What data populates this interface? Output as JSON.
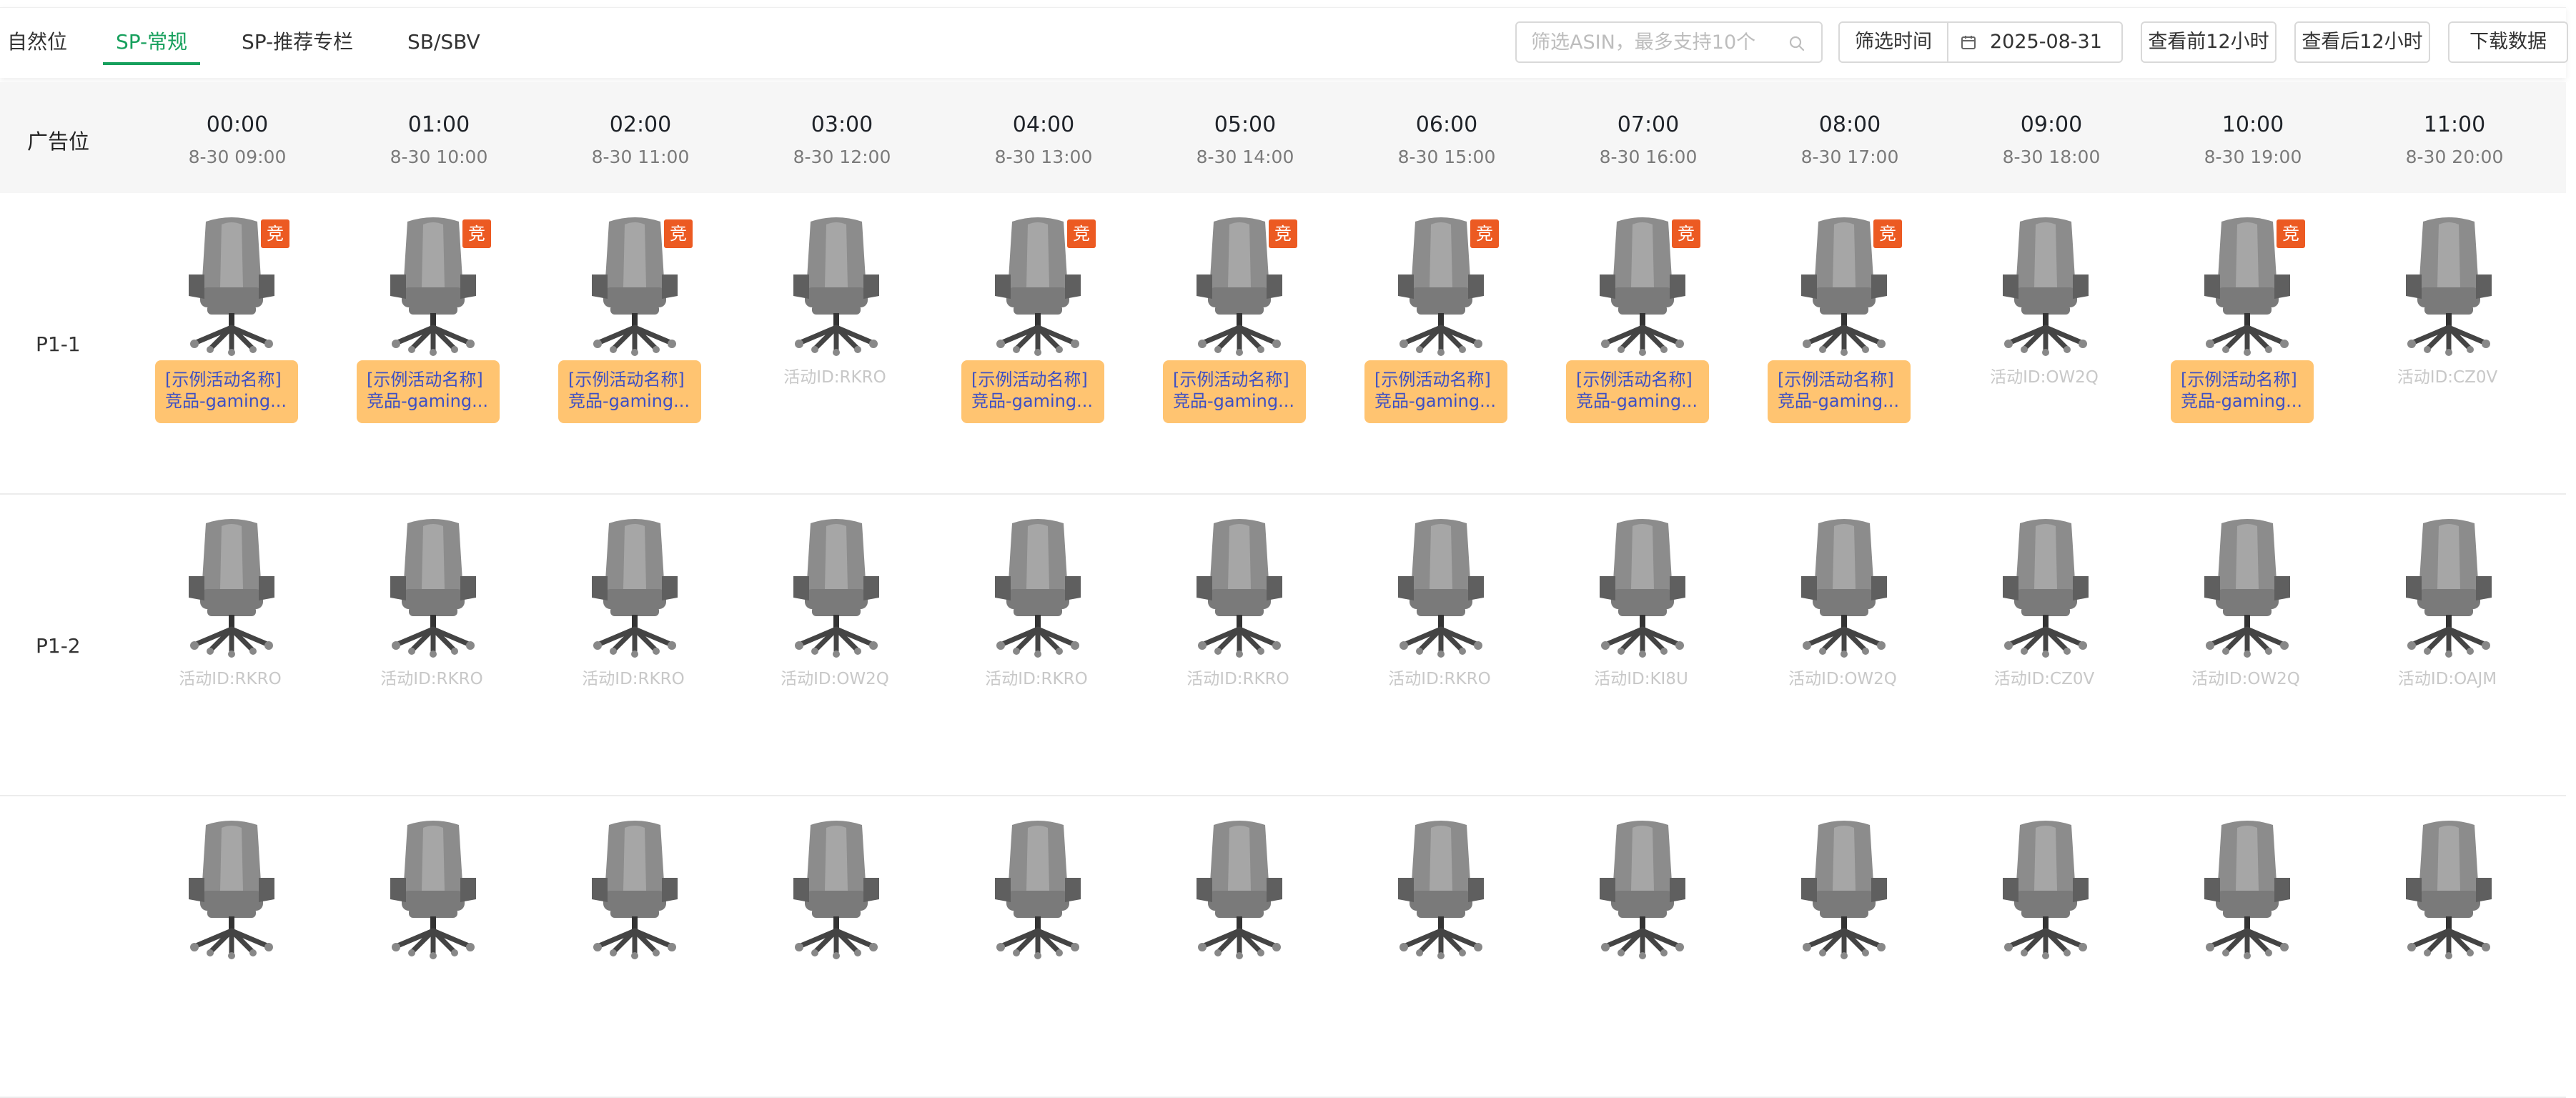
{
  "tabs": [
    {
      "label": "自然位",
      "active": false
    },
    {
      "label": "SP-常规",
      "active": true
    },
    {
      "label": "SP-推荐专栏",
      "active": false
    },
    {
      "label": "SB/SBV",
      "active": false
    }
  ],
  "controls": {
    "search_placeholder": "筛选ASIN，最多支持10个",
    "filter_time_label": "筛选时间",
    "date_value": "2025-08-31",
    "prev_12h_label": "查看前12小时",
    "next_12h_label": "查看后12小时",
    "download_label": "下载数据"
  },
  "colors": {
    "accent": "#17a05d",
    "badge": "#ec5a22",
    "campaign_box": "#ffc471",
    "campaign_text": "#3d4fc4",
    "header_bg": "#f6f6f6"
  },
  "grid": {
    "corner_label": "广告位",
    "columns": [
      {
        "hour": "00:00",
        "slot": "8-30 09:00"
      },
      {
        "hour": "01:00",
        "slot": "8-30 10:00"
      },
      {
        "hour": "02:00",
        "slot": "8-30 11:00"
      },
      {
        "hour": "03:00",
        "slot": "8-30 12:00"
      },
      {
        "hour": "04:00",
        "slot": "8-30 13:00"
      },
      {
        "hour": "05:00",
        "slot": "8-30 14:00"
      },
      {
        "hour": "06:00",
        "slot": "8-30 15:00"
      },
      {
        "hour": "07:00",
        "slot": "8-30 16:00"
      },
      {
        "hour": "08:00",
        "slot": "8-30 17:00"
      },
      {
        "hour": "09:00",
        "slot": "8-30 18:00"
      },
      {
        "hour": "10:00",
        "slot": "8-30 19:00"
      },
      {
        "hour": "11:00",
        "slot": "8-30 20:00"
      }
    ],
    "rows": [
      {
        "label": "P1-1",
        "cells": [
          {
            "chair": "bw-gaming",
            "badge": "竞",
            "campaign": [
              "[示例活动名称]",
              "竞品-gaming..."
            ]
          },
          {
            "chair": "bw-gaming",
            "badge": "竞",
            "campaign": [
              "[示例活动名称]",
              "竞品-gaming..."
            ]
          },
          {
            "chair": "bw-gaming",
            "badge": "竞",
            "campaign": [
              "[示例活动名称]",
              "竞品-gaming..."
            ]
          },
          {
            "chair": "navy-white",
            "activity_id": "活动ID:RKRO"
          },
          {
            "chair": "bw-gaming",
            "badge": "竞",
            "campaign": [
              "[示例活动名称]",
              "竞品-gaming..."
            ]
          },
          {
            "chair": "bw-gaming",
            "badge": "竞",
            "campaign": [
              "[示例活动名称]",
              "竞品-gaming..."
            ]
          },
          {
            "chair": "bw-gaming",
            "badge": "竞",
            "campaign": [
              "[示例活动名称]",
              "竞品-gaming..."
            ]
          },
          {
            "chair": "bw-gaming",
            "badge": "竞",
            "campaign": [
              "[示例活动名称]",
              "竞品-gaming..."
            ]
          },
          {
            "chair": "bw-gaming",
            "badge": "竞",
            "campaign": [
              "[示例活动名称]",
              "竞品-gaming..."
            ]
          },
          {
            "chair": "black-office",
            "activity_id": "活动ID:OW2Q"
          },
          {
            "chair": "bw-gaming",
            "badge": "竞",
            "campaign": [
              "[示例活动名称]",
              "竞品-gaming..."
            ]
          },
          {
            "chair": "black-office",
            "activity_id": "活动ID:CZ0V"
          }
        ]
      },
      {
        "label": "P1-2",
        "cells": [
          {
            "chair": "navy-white",
            "activity_id": "活动ID:RKRO"
          },
          {
            "chair": "navy-white",
            "activity_id": "活动ID:RKRO"
          },
          {
            "chair": "navy-white",
            "activity_id": "活动ID:RKRO"
          },
          {
            "chair": "black-office",
            "activity_id": "活动ID:OW2Q"
          },
          {
            "chair": "navy-white",
            "activity_id": "活动ID:RKRO"
          },
          {
            "chair": "navy-white",
            "activity_id": "活动ID:RKRO"
          },
          {
            "chair": "navy-white",
            "activity_id": "活动ID:RKRO"
          },
          {
            "chair": "black-office",
            "activity_id": "活动ID:KI8U"
          },
          {
            "chair": "black-office",
            "activity_id": "活动ID:OW2Q"
          },
          {
            "chair": "black-office",
            "activity_id": "活动ID:CZ0V"
          },
          {
            "chair": "black-office",
            "activity_id": "活动ID:OW2Q"
          },
          {
            "chair": "black-office",
            "activity_id": "活动ID:OAJM"
          }
        ]
      },
      {
        "label": "",
        "cells": [
          {
            "chair": "black-office"
          },
          {
            "chair": "black-office"
          },
          {
            "chair": "black-office"
          },
          {
            "chair": "grey-office"
          },
          {
            "chair": "black-office"
          },
          {
            "chair": "black-office"
          },
          {
            "chair": "black-office"
          },
          {
            "chair": "navy-white"
          },
          {
            "chair": "black-office"
          },
          {
            "chair": "black-office"
          },
          {
            "chair": "black-office"
          },
          {
            "chair": "grey-office"
          }
        ]
      }
    ]
  }
}
